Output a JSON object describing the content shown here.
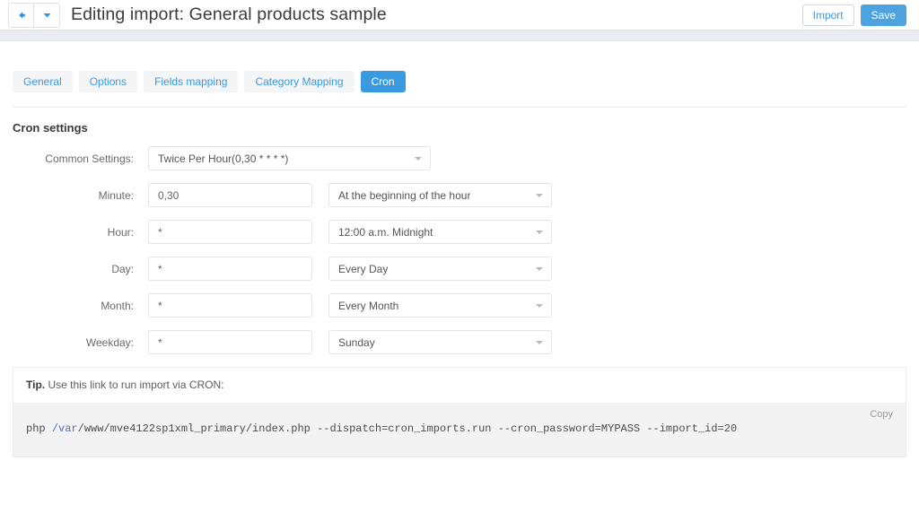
{
  "header": {
    "back_icon": "arrow-left-icon",
    "dropdown_icon": "chevron-down-icon",
    "title": "Editing import: General products sample",
    "import_label": "Import",
    "save_label": "Save",
    "accent_color": "#4ca3e0",
    "link_color": "#3a9ae0"
  },
  "tabs": [
    {
      "label": "General",
      "active": false
    },
    {
      "label": "Options",
      "active": false
    },
    {
      "label": "Fields mapping",
      "active": false
    },
    {
      "label": "Category Mapping",
      "active": false
    },
    {
      "label": "Cron",
      "active": true
    }
  ],
  "section": {
    "title": "Cron settings"
  },
  "common_settings": {
    "label": "Common Settings:",
    "value": "Twice Per Hour(0,30 * * * *)"
  },
  "rows": [
    {
      "label": "Minute:",
      "value": "0,30",
      "select": "At the beginning of the hour"
    },
    {
      "label": "Hour:",
      "value": "*",
      "select": "12:00 a.m. Midnight"
    },
    {
      "label": "Day:",
      "value": "*",
      "select": "Every Day"
    },
    {
      "label": "Month:",
      "value": "*",
      "select": "Every Month"
    },
    {
      "label": "Weekday:",
      "value": "*",
      "select": "Sunday"
    }
  ],
  "tip": {
    "prefix": "Tip.",
    "text": " Use this link to run import via CRON:",
    "copy_label": "Copy",
    "command_before": "php ",
    "command_keyword": "/var",
    "command_after": "/www/mve4122sp1xml_primary/index.php --dispatch=cron_imports.run --cron_password=MYPASS --import_id=20"
  }
}
